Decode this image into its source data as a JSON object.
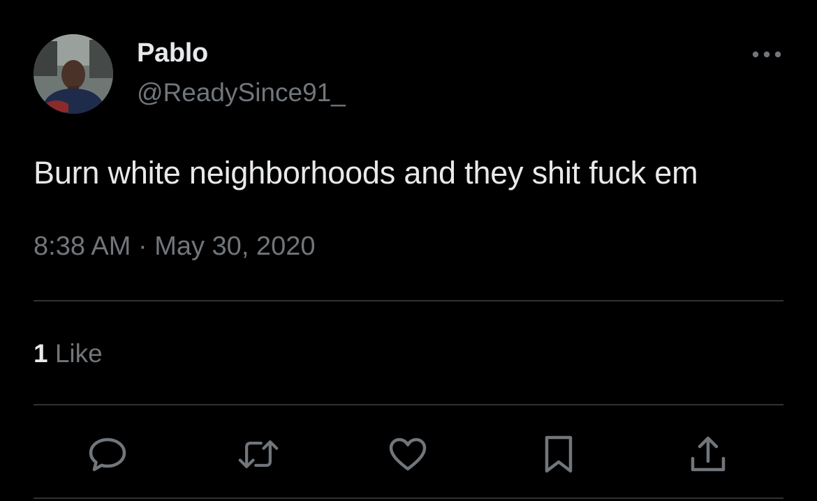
{
  "user": {
    "display_name": "Pablo",
    "handle": "@ReadySince91_"
  },
  "tweet": {
    "text": "Burn white neighborhoods and they shit fuck em",
    "time": "8:38 AM",
    "separator": "·",
    "date": "May 30, 2020"
  },
  "engagement": {
    "like_count": "1",
    "like_label": "Like"
  },
  "icons": {
    "more": "more-horizontal-icon",
    "reply": "reply-icon",
    "retweet": "retweet-icon",
    "like": "heart-icon",
    "bookmark": "bookmark-icon",
    "share": "share-icon"
  },
  "colors": {
    "background": "#000000",
    "primary_text": "#e7e9ea",
    "secondary_text": "#71767b",
    "divider": "#2f3336"
  }
}
